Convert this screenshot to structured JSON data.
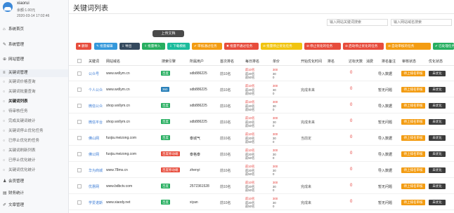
{
  "profile": {
    "username": "xiaorui",
    "balance": "余额:1.00元",
    "time": "2020-03-14 17:02:46"
  },
  "nav": [
    {
      "icon": "home-icon",
      "glyph": "⌂",
      "label": "系统首页",
      "type": "main"
    },
    {
      "icon": "wrench-icon",
      "glyph": "✎",
      "label": "系统管理",
      "type": "main"
    },
    {
      "icon": "globe-icon",
      "glyph": "⊕",
      "label": "网站管理",
      "type": "main"
    },
    {
      "icon": "list-icon",
      "glyph": "≡",
      "label": "关键词管理",
      "type": "main"
    },
    {
      "icon": "circle-icon",
      "glyph": "○",
      "label": "关键词价格查询",
      "type": "sub"
    },
    {
      "icon": "circle-icon",
      "glyph": "○",
      "label": "关键词批量查询",
      "type": "sub"
    },
    {
      "icon": "circle-icon",
      "glyph": "○",
      "label": "关键词列表",
      "type": "sub",
      "active": true
    },
    {
      "icon": "circle-icon",
      "glyph": "○",
      "label": "待审核任务",
      "type": "sub"
    },
    {
      "icon": "circle-icon",
      "glyph": "○",
      "label": "完成关键词统计",
      "type": "sub"
    },
    {
      "icon": "circle-icon",
      "glyph": "○",
      "label": "关键词停止优化任务",
      "type": "sub"
    },
    {
      "icon": "circle-icon",
      "glyph": "○",
      "label": "已停止优化的任务",
      "type": "sub"
    },
    {
      "icon": "circle-icon",
      "glyph": "○",
      "label": "关键词刷新列表",
      "type": "sub"
    },
    {
      "icon": "circle-icon",
      "glyph": "○",
      "label": "已停止优化统计",
      "type": "sub"
    },
    {
      "icon": "circle-icon",
      "glyph": "○",
      "label": "关键词优化统计",
      "type": "sub"
    },
    {
      "icon": "user-icon",
      "glyph": "♟",
      "label": "会员管理",
      "type": "main"
    },
    {
      "icon": "chart-icon",
      "glyph": "▤",
      "label": "财务统计",
      "type": "main"
    },
    {
      "icon": "doc-icon",
      "glyph": "✐",
      "label": "文章管理",
      "type": "main"
    }
  ],
  "header": {
    "title": "关键词列表"
  },
  "search": [
    {
      "placeholder": "输入网站关键词搜索"
    },
    {
      "placeholder": "输入网站域名搜索"
    }
  ],
  "upload_label": "上传文档",
  "toolbar": [
    {
      "label": "✖ 删除",
      "color": "#e74c3c"
    },
    {
      "label": "✎ 批量编辑",
      "color": "#3498db"
    },
    {
      "label": "⇩ 导出",
      "color": "#34495e"
    },
    {
      "label": "⇧ 批量导入",
      "color": "#27ae60"
    },
    {
      "label": "⇩ 下载模板",
      "color": "#1abc9c"
    },
    {
      "label": "✔ 审核通过任务",
      "color": "#f39c12"
    },
    {
      "label": "✖ 批量不通过任务",
      "color": "#e74c3c"
    },
    {
      "label": "⊘ 批量停止优化任务",
      "color": "#f1c40f"
    },
    {
      "label": "⊘ 停止优化的任务",
      "color": "#e74c3c"
    },
    {
      "label": "⊘ 启动停止优化的任务",
      "color": "#e74c3c"
    },
    {
      "label": "⊘ 自动审核的任务",
      "color": "#f39c12"
    },
    {
      "label": "✔ 已处理任务",
      "color": "#27ae60"
    }
  ],
  "columns": [
    "关键词",
    "网站域名",
    "搜索引擎",
    "所属用户",
    "首次排名",
    "每日排名",
    "单价",
    "开始优化时间",
    "排名",
    "达标天数",
    "消费",
    "排名备注",
    "审核状态",
    "优化状态"
  ],
  "rows": [
    {
      "keyword": "公众号",
      "domain": "www.wxllym.cn",
      "engine": "百度",
      "engine_color": "#27ae60",
      "user": "sdb886225",
      "first": "前10名",
      "rank": [
        "前10名",
        "前20名",
        "前50名"
      ],
      "price": [
        "300",
        "30",
        "0"
      ],
      "start": "",
      "pos": "",
      "days": "0",
      "cost": "",
      "note": "导入数据",
      "audit": "待上排名审核",
      "opt": "未优化"
    },
    {
      "keyword": "个人公众",
      "domain": "www.wxllym.cn",
      "engine": "360",
      "engine_color": "#2980b9",
      "user": "sdb886225",
      "first": "前10名",
      "rank": [
        "前10名",
        "前20名",
        "前50名"
      ],
      "price": [
        "300",
        "30",
        "0"
      ],
      "start": "完成未来",
      "pos": "",
      "days": "0",
      "cost": "",
      "note": "暂无问题",
      "audit": "待上排名审核",
      "opt": "未优化"
    },
    {
      "keyword": "微信公众",
      "domain": "shop.wxllym.cn",
      "engine": "百度",
      "engine_color": "#27ae60",
      "user": "sdb886225",
      "first": "前10名",
      "rank": [
        "前10名",
        "前20名",
        "前50名"
      ],
      "price": [
        "300",
        "30",
        "0"
      ],
      "start": "",
      "pos": "",
      "days": "0",
      "cost": "",
      "note": "导入数据",
      "audit": "待上排名审核",
      "opt": "未优化"
    },
    {
      "keyword": "微信平台",
      "domain": "shop.wxllym.cn",
      "engine": "百度",
      "engine_color": "#27ae60",
      "user": "sdb886225",
      "first": "前10名",
      "rank": [
        "前10名",
        "前20名",
        "前50名"
      ],
      "price": [
        "300",
        "30",
        "0"
      ],
      "start": "完成未来",
      "pos": "",
      "days": "0",
      "cost": "",
      "note": "暂无问题",
      "audit": "待上排名审核",
      "opt": "未优化"
    },
    {
      "keyword": "佛山网",
      "domain": "fuojia.meizong.com",
      "engine": "百度",
      "engine_color": "#27ae60",
      "user": "泰城气",
      "first": "前10名",
      "rank": [
        "前10名",
        "前20名",
        "前50名"
      ],
      "price": [
        "300",
        "30",
        "0"
      ],
      "start": "当前定",
      "pos": "",
      "days": "0",
      "cost": "",
      "note": "导入数据",
      "audit": "待上排名审核",
      "opt": "未优化"
    },
    {
      "keyword": "佛公网",
      "domain": "fuojia.meizong.com",
      "engine": "百度移动端",
      "engine_color": "#e74c3c",
      "user": "泰格泰",
      "first": "前10名",
      "rank": [
        "前10名",
        "前20名",
        "前50名"
      ],
      "price": [
        "300",
        "30",
        "0"
      ],
      "start": "",
      "pos": "",
      "days": "0",
      "cost": "",
      "note": "导入数据",
      "audit": "待上排名审核",
      "opt": "未优化"
    },
    {
      "keyword": "华为商城",
      "domain": "www.78ms.cn",
      "engine": "百度移动端",
      "engine_color": "#e74c3c",
      "user": "zhenyi",
      "first": "前10名",
      "rank": [
        "前10名",
        "前20名",
        "前50名"
      ],
      "price": [
        "300",
        "30",
        "0"
      ],
      "start": "",
      "pos": "",
      "days": "0",
      "cost": "",
      "note": "导入数据",
      "audit": "待上排名审核",
      "opt": "未优化"
    },
    {
      "keyword": "优惠网",
      "domain": "www.bdbctv.com",
      "engine": "百度",
      "engine_color": "#27ae60",
      "user": "2572361528",
      "first": "前10名",
      "rank": [
        "前10名",
        "前20名",
        "前50名"
      ],
      "price": [
        "300",
        "30",
        "0"
      ],
      "start": "完成来",
      "pos": "",
      "days": "0",
      "cost": "",
      "note": "暂无问题",
      "audit": "待上排名审核",
      "opt": "未优化"
    },
    {
      "keyword": "学爱诺斯",
      "domain": "www.xiaody.net",
      "engine": "百度",
      "engine_color": "#27ae60",
      "user": "xiyan",
      "first": "前10名",
      "rank": [
        "前10名",
        "前20名",
        "前50名"
      ],
      "price": [
        "300",
        "30",
        "0"
      ],
      "start": "完成来",
      "pos": "",
      "days": "0",
      "cost": "",
      "note": "暂无问题",
      "audit": "待上排名审核",
      "opt": "未优化"
    }
  ]
}
